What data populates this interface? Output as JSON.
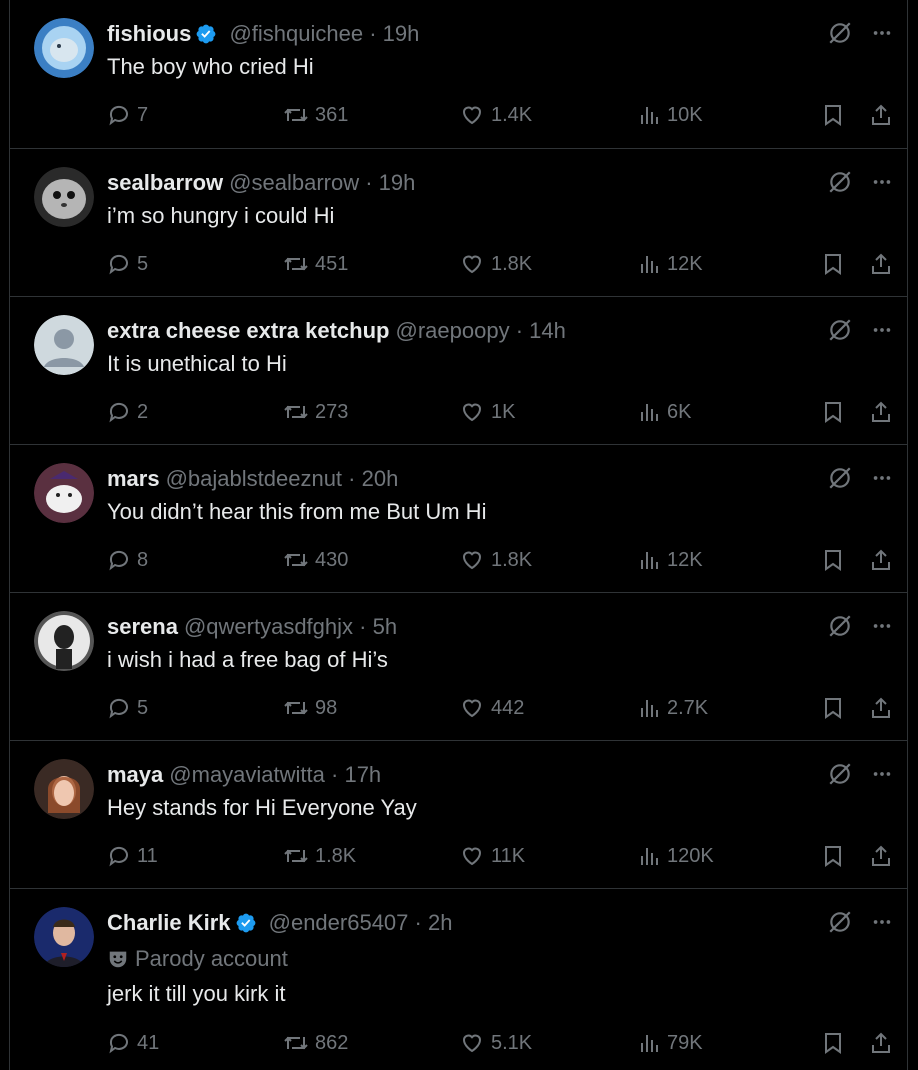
{
  "colors": {
    "background": "#000000",
    "text": "#e7e9ea",
    "muted": "#71767b",
    "divider": "#2f3336",
    "verified": "#1d9bf0"
  },
  "tweets": [
    {
      "name": "fishious",
      "verified": true,
      "handle": "@fishquichee",
      "time": "19h",
      "text": "The boy who cried Hi",
      "replies": "7",
      "retweets": "361",
      "likes": "1.4K",
      "views": "10K"
    },
    {
      "name": "sealbarrow",
      "verified": false,
      "handle": "@sealbarrow",
      "time": "19h",
      "text": "i’m so hungry i could Hi",
      "replies": "5",
      "retweets": "451",
      "likes": "1.8K",
      "views": "12K"
    },
    {
      "name": "extra cheese extra ketchup",
      "verified": false,
      "handle": "@raepoopy",
      "time": "14h",
      "text": "It is unethical to Hi",
      "replies": "2",
      "retweets": "273",
      "likes": "1K",
      "views": "6K"
    },
    {
      "name": "mars",
      "verified": false,
      "handle": "@bajablstdeeznut",
      "time": "20h",
      "text": "You didn’t hear this from me But Um Hi",
      "replies": "8",
      "retweets": "430",
      "likes": "1.8K",
      "views": "12K"
    },
    {
      "name": "serena",
      "verified": false,
      "handle": "@qwertyasdfghjx",
      "time": "5h",
      "text": "i wish i had a free bag of Hi’s",
      "replies": "5",
      "retweets": "98",
      "likes": "442",
      "views": "2.7K"
    },
    {
      "name": "maya",
      "verified": false,
      "handle": "@mayaviatwitta",
      "time": "17h",
      "text": "Hey stands for Hi Everyone Yay",
      "replies": "11",
      "retweets": "1.8K",
      "likes": "11K",
      "views": "120K"
    },
    {
      "name": "Charlie Kirk",
      "verified": true,
      "handle": "@ender65407",
      "time": "2h",
      "parody_label": "Parody account",
      "text": "jerk it till you kirk it",
      "replies": "41",
      "retweets": "862",
      "likes": "5.1K",
      "views": "79K"
    }
  ]
}
